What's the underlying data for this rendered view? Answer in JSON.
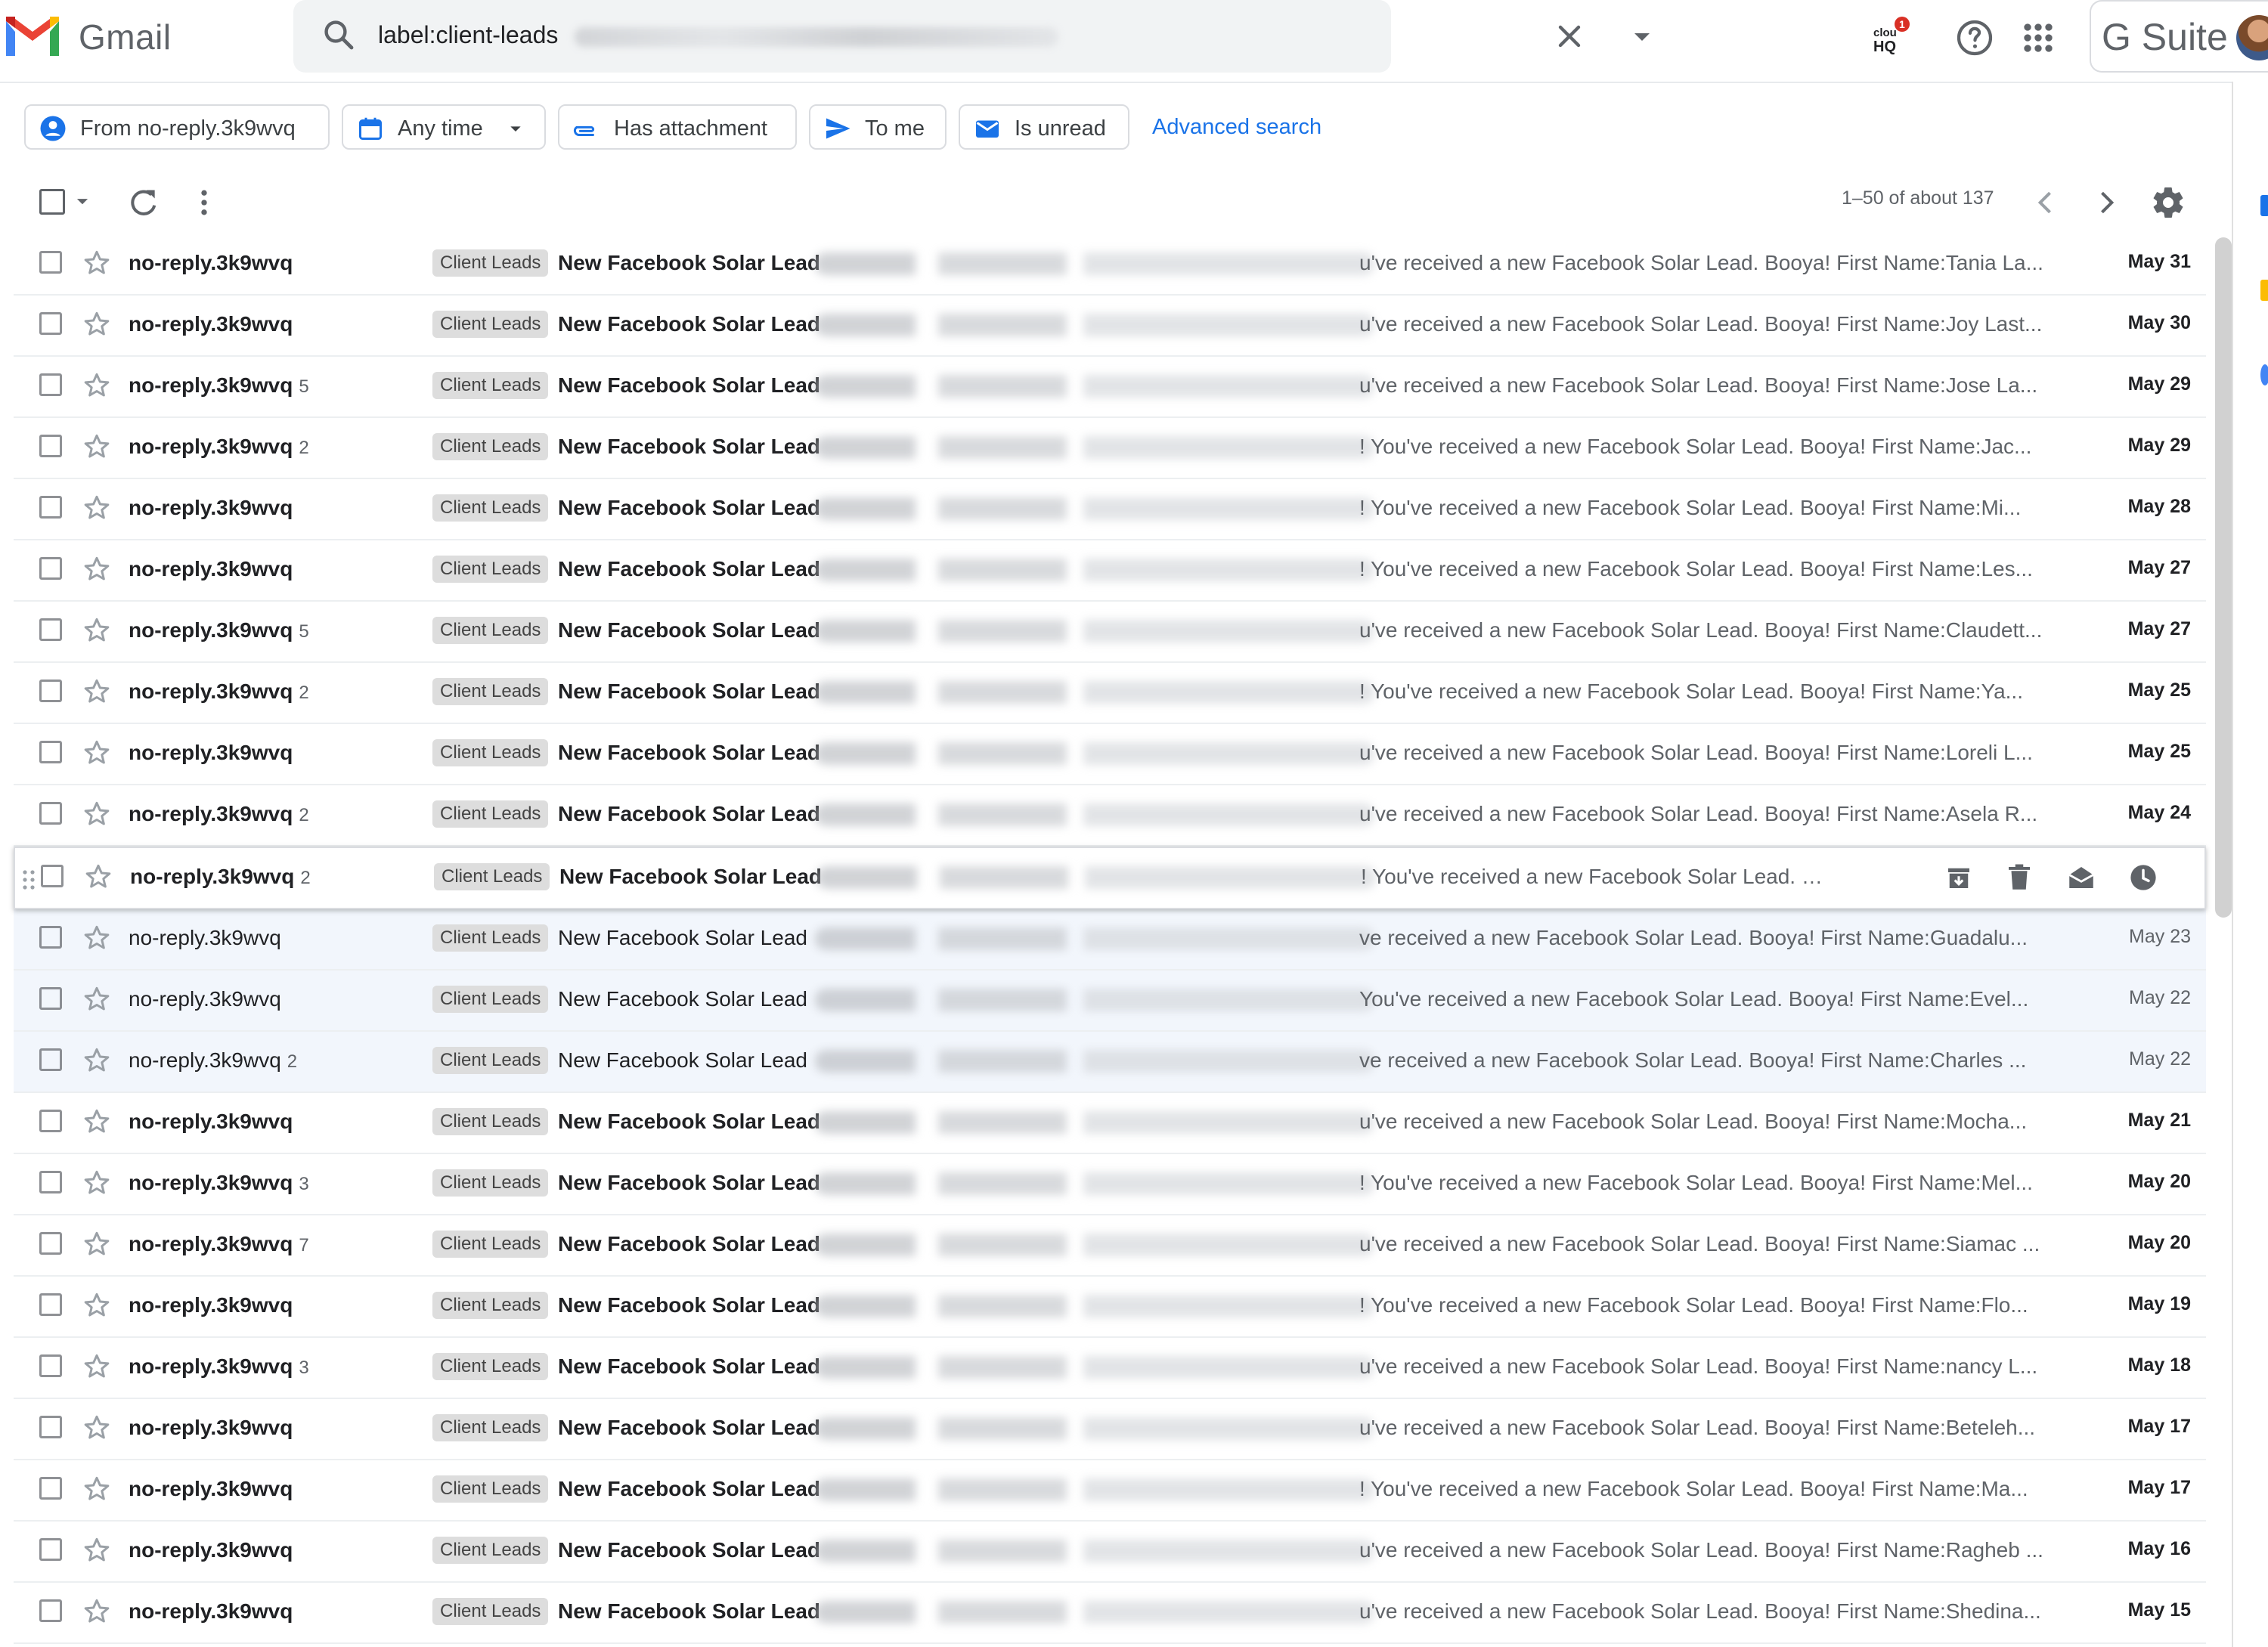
{
  "app": {
    "name": "Gmail",
    "suite": "G Suite"
  },
  "search": {
    "query": "label:client-leads"
  },
  "header_icons": {
    "cloudhq_badge": "1"
  },
  "filters": {
    "from": "From no-reply.3k9wvq",
    "time": "Any time",
    "attachment": "Has attachment",
    "to_me": "To me",
    "unread": "Is unread",
    "advanced": "Advanced search"
  },
  "toolbar": {
    "pager": "1–50 of about 137"
  },
  "colors": {
    "accent": "#1a73e8",
    "label_bg": "#dddddd",
    "read_row_bg": "#f2f6fc"
  },
  "rows": [
    {
      "sender": "no-reply.3k9wvq",
      "count": "",
      "label": "Client Leads",
      "subject": "New Facebook Solar Lead",
      "snippet": "u've received a new Facebook Solar Lead. Booya! First Name:Tania La...",
      "date": "May 31"
    },
    {
      "sender": "no-reply.3k9wvq",
      "count": "",
      "label": "Client Leads",
      "subject": "New Facebook Solar Lead",
      "snippet": "u've received a new Facebook Solar Lead. Booya! First Name:Joy Last...",
      "date": "May 30"
    },
    {
      "sender": "no-reply.3k9wvq",
      "count": "5",
      "label": "Client Leads",
      "subject": "New Facebook Solar Lead",
      "snippet": "u've received a new Facebook Solar Lead. Booya! First Name:Jose La...",
      "date": "May 29"
    },
    {
      "sender": "no-reply.3k9wvq",
      "count": "2",
      "label": "Client Leads",
      "subject": "New Facebook Solar Lead",
      "snippet": "! You've received a new Facebook Solar Lead. Booya! First Name:Jac...",
      "date": "May 29"
    },
    {
      "sender": "no-reply.3k9wvq",
      "count": "",
      "label": "Client Leads",
      "subject": "New Facebook Solar Lead",
      "snippet": "! You've received a new Facebook Solar Lead. Booya! First Name:Mi...",
      "date": "May 28"
    },
    {
      "sender": "no-reply.3k9wvq",
      "count": "",
      "label": "Client Leads",
      "subject": "New Facebook Solar Lead",
      "snippet": "! You've received a new Facebook Solar Lead. Booya! First Name:Les...",
      "date": "May 27"
    },
    {
      "sender": "no-reply.3k9wvq",
      "count": "5",
      "label": "Client Leads",
      "subject": "New Facebook Solar Lead",
      "snippet": "u've received a new Facebook Solar Lead. Booya! First Name:Claudett...",
      "date": "May 27"
    },
    {
      "sender": "no-reply.3k9wvq",
      "count": "2",
      "label": "Client Leads",
      "subject": "New Facebook Solar Lead",
      "snippet": "! You've received a new Facebook Solar Lead. Booya! First Name:Ya...",
      "date": "May 25"
    },
    {
      "sender": "no-reply.3k9wvq",
      "count": "",
      "label": "Client Leads",
      "subject": "New Facebook Solar Lead",
      "snippet": "u've received a new Facebook Solar Lead. Booya! First Name:Loreli L...",
      "date": "May 25"
    },
    {
      "sender": "no-reply.3k9wvq",
      "count": "2",
      "label": "Client Leads",
      "subject": "New Facebook Solar Lead",
      "snippet": "u've received a new Facebook Solar Lead. Booya! First Name:Asela R...",
      "date": "May 24"
    },
    {
      "sender": "no-reply.3k9wvq",
      "count": "2",
      "label": "Client Leads",
      "subject": "New Facebook Solar Lead",
      "snippet": "! You've received a new Facebook Solar Lead. Booya! First...",
      "date": "",
      "hover": true
    },
    {
      "sender": "no-reply.3k9wvq",
      "count": "",
      "label": "Client Leads",
      "subject": "New Facebook Solar Lead",
      "snippet": "ve received a new Facebook Solar Lead. Booya! First Name:Guadalu...",
      "date": "May 23",
      "read": true
    },
    {
      "sender": "no-reply.3k9wvq",
      "count": "",
      "label": "Client Leads",
      "subject": "New Facebook Solar Lead",
      "snippet": "You've received a new Facebook Solar Lead. Booya! First Name:Evel...",
      "date": "May 22",
      "read": true
    },
    {
      "sender": "no-reply.3k9wvq",
      "count": "2",
      "label": "Client Leads",
      "subject": "New Facebook Solar Lead",
      "snippet": "ve received a new Facebook Solar Lead. Booya! First Name:Charles ...",
      "date": "May 22",
      "read": true
    },
    {
      "sender": "no-reply.3k9wvq",
      "count": "",
      "label": "Client Leads",
      "subject": "New Facebook Solar Lead",
      "snippet": "u've received a new Facebook Solar Lead. Booya! First Name:Mocha...",
      "date": "May 21"
    },
    {
      "sender": "no-reply.3k9wvq",
      "count": "3",
      "label": "Client Leads",
      "subject": "New Facebook Solar Lead",
      "snippet": "! You've received a new Facebook Solar Lead. Booya! First Name:Mel...",
      "date": "May 20"
    },
    {
      "sender": "no-reply.3k9wvq",
      "count": "7",
      "label": "Client Leads",
      "subject": "New Facebook Solar Lead",
      "snippet": "u've received a new Facebook Solar Lead. Booya! First Name:Siamac ...",
      "date": "May 20"
    },
    {
      "sender": "no-reply.3k9wvq",
      "count": "",
      "label": "Client Leads",
      "subject": "New Facebook Solar Lead",
      "snippet": "! You've received a new Facebook Solar Lead. Booya! First Name:Flo...",
      "date": "May 19"
    },
    {
      "sender": "no-reply.3k9wvq",
      "count": "3",
      "label": "Client Leads",
      "subject": "New Facebook Solar Lead",
      "snippet": "u've received a new Facebook Solar Lead. Booya! First Name:nancy L...",
      "date": "May 18"
    },
    {
      "sender": "no-reply.3k9wvq",
      "count": "",
      "label": "Client Leads",
      "subject": "New Facebook Solar Lead",
      "snippet": "u've received a new Facebook Solar Lead. Booya! First Name:Beteleh...",
      "date": "May 17"
    },
    {
      "sender": "no-reply.3k9wvq",
      "count": "",
      "label": "Client Leads",
      "subject": "New Facebook Solar Lead",
      "snippet": "! You've received a new Facebook Solar Lead. Booya! First Name:Ma...",
      "date": "May 17"
    },
    {
      "sender": "no-reply.3k9wvq",
      "count": "",
      "label": "Client Leads",
      "subject": "New Facebook Solar Lead",
      "snippet": "u've received a new Facebook Solar Lead. Booya! First Name:Ragheb ...",
      "date": "May 16"
    },
    {
      "sender": "no-reply.3k9wvq",
      "count": "",
      "label": "Client Leads",
      "subject": "New Facebook Solar Lead",
      "snippet": "u've received a new Facebook Solar Lead. Booya! First Name:Shedina...",
      "date": "May 15"
    }
  ],
  "icons": [
    "gmail-logo",
    "search-icon",
    "close-icon",
    "dropdown-arrow-icon",
    "cloudhq-icon",
    "help-icon",
    "apps-grid-icon",
    "person-icon",
    "calendar-icon",
    "paperclip-icon",
    "send-icon",
    "envelope-icon",
    "checkbox-icon",
    "refresh-icon",
    "more-vert-icon",
    "chevron-left-icon",
    "chevron-right-icon",
    "settings-gear-icon",
    "star-icon",
    "drag-handle-icon",
    "archive-icon",
    "delete-icon",
    "mark-read-icon",
    "snooze-icon"
  ]
}
